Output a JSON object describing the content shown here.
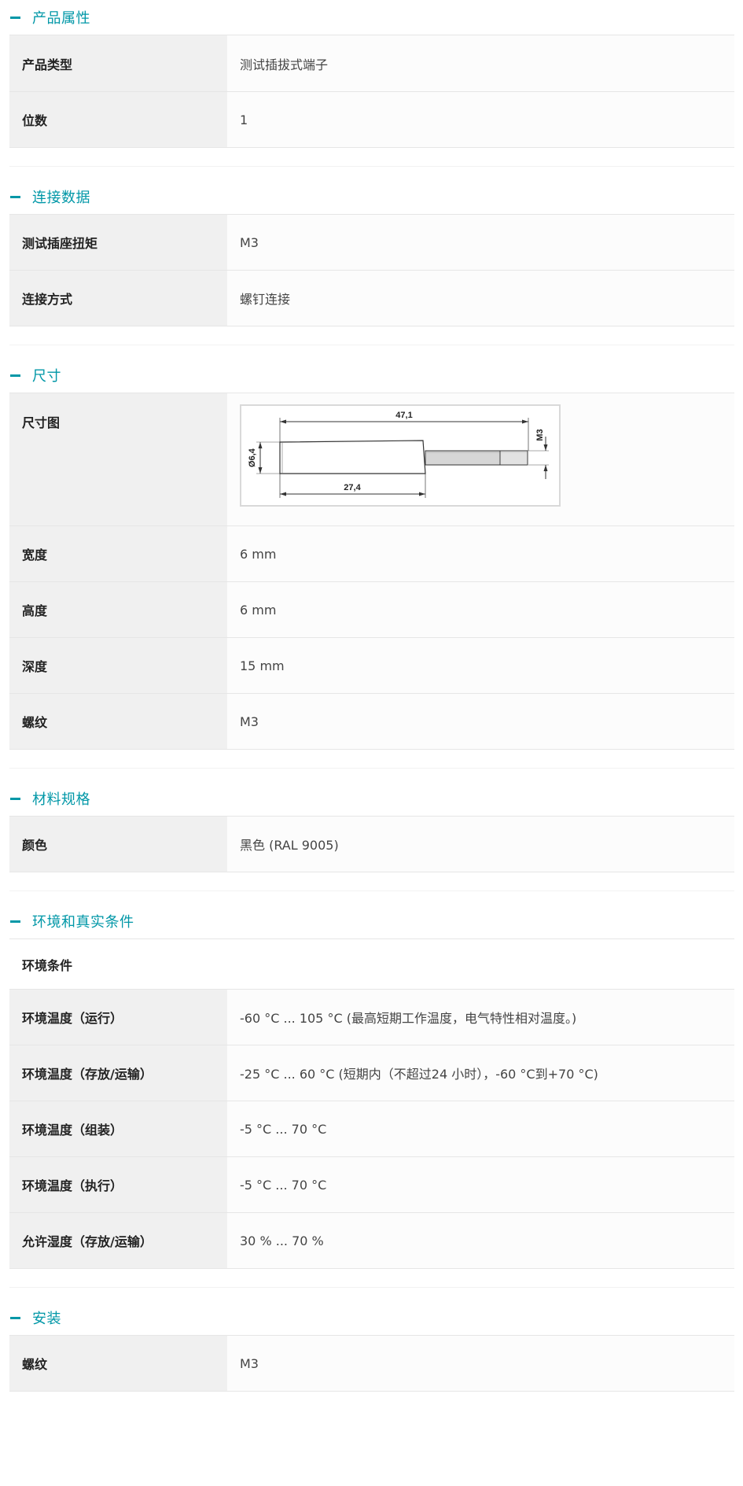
{
  "sections": {
    "product": {
      "title": "产品属性",
      "rows": [
        {
          "label": "产品类型",
          "value": "测试插拔式端子"
        },
        {
          "label": "位数",
          "value": "1"
        }
      ]
    },
    "connection": {
      "title": "连接数据",
      "rows": [
        {
          "label": "测试插座扭矩",
          "value": "M3"
        },
        {
          "label": "连接方式",
          "value": "螺钉连接"
        }
      ]
    },
    "dimensions": {
      "title": "尺寸",
      "drawing_label": "尺寸图",
      "drawing": {
        "dim_total": "47,1",
        "dim_body": "27,4",
        "dim_diameter": "Ø6,4",
        "dim_thread": "M3"
      },
      "rows": [
        {
          "label": "宽度",
          "value": "6 mm"
        },
        {
          "label": "高度",
          "value": "6 mm"
        },
        {
          "label": "深度",
          "value": "15 mm"
        },
        {
          "label": "螺纹",
          "value": "M3"
        }
      ]
    },
    "material": {
      "title": "材料规格",
      "rows": [
        {
          "label": "颜色",
          "value": "黑色 (RAL 9005)"
        }
      ]
    },
    "environment": {
      "title": "环境和真实条件",
      "subheading": "环境条件",
      "rows": [
        {
          "label": "环境温度（运行）",
          "value": "-60 °C ... 105 °C (最高短期工作温度，电气特性相对温度。)"
        },
        {
          "label": "环境温度（存放/运输）",
          "value": "-25 °C ... 60 °C (短期内（不超过24 小时），-60 °C到+70 °C)"
        },
        {
          "label": "环境温度（组装）",
          "value": "-5 °C ... 70 °C"
        },
        {
          "label": "环境温度（执行）",
          "value": "-5 °C ... 70 °C"
        },
        {
          "label": "允许湿度（存放/运输）",
          "value": "30 % ... 70 %"
        }
      ]
    },
    "installation": {
      "title": "安装",
      "rows": [
        {
          "label": "螺纹",
          "value": "M3"
        }
      ]
    }
  },
  "colors": {
    "accent": "#0097a7",
    "label_bg": "#f0f0f0",
    "border": "#e6e6e6"
  },
  "icons": {
    "section_toggle": "minus-icon"
  }
}
